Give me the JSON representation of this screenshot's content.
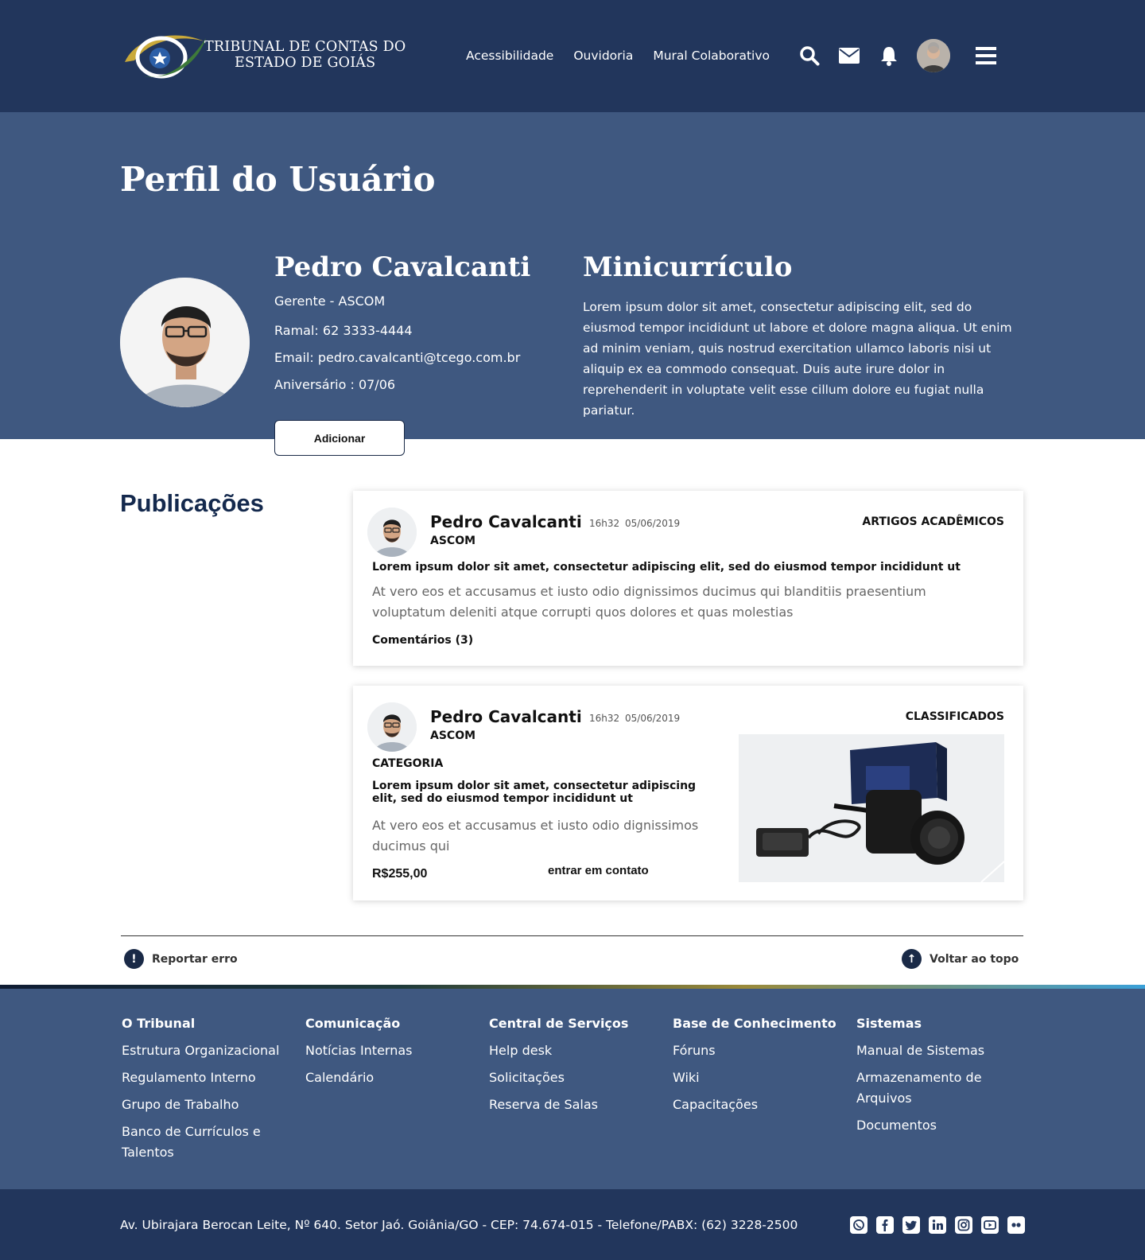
{
  "header": {
    "logo_line1": "TRIBUNAL DE CONTAS DO",
    "logo_line2": "ESTADO DE GOIÁS",
    "nav": [
      "Acessibilidade",
      "Ouvidoria",
      "Mural Colaborativo"
    ],
    "icons": [
      "search-icon",
      "mail-icon",
      "bell-icon",
      "avatar",
      "menu-icon"
    ]
  },
  "profile": {
    "page_title": "Perfil do Usuário",
    "name": "Pedro Cavalcanti",
    "role": "Gerente - ASCOM",
    "extension": "Ramal: 62 3333-4444",
    "email": "Email: pedro.cavalcanti@tcego.com.br",
    "birthday": "Aniversário : 07/06",
    "add_button": "Adicionar",
    "cv_title": "Minicurrículo",
    "cv_text": "Lorem ipsum dolor sit amet, consectetur adipiscing elit, sed do eiusmod tempor incididunt ut labore et dolore magna aliqua. Ut enim ad minim veniam, quis nostrud exercitation ullamco laboris nisi ut aliquip ex ea commodo consequat. Duis aute irure dolor in reprehenderit in voluptate velit esse cillum dolore eu fugiat nulla pariatur."
  },
  "publications": {
    "title": "Publicações",
    "posts": [
      {
        "author": "Pedro Cavalcanti",
        "dept": "ASCOM",
        "time": "16h32",
        "date": "05/06/2019",
        "tag": "ARTIGOS ACADÊMICOS",
        "headline": "Lorem ipsum dolor sit amet, consectetur adipiscing elit, sed do eiusmod tempor incididunt ut",
        "body": "At vero eos et accusamus et iusto odio dignissimos ducimus qui blanditiis praesentium voluptatum deleniti atque corrupti quos dolores et quas molestias",
        "comments": "Comentários (3)"
      },
      {
        "author": "Pedro Cavalcanti",
        "dept": "ASCOM",
        "time": "16h32",
        "date": "05/06/2019",
        "tag": "CLASSIFICADOS",
        "category": "CATEGORIA",
        "headline": "Lorem ipsum dolor sit amet, consectetur adipiscing elit, sed do eiusmod tempor incididunt ut",
        "body": "At vero eos et accusamus et iusto odio dignissimos ducimus qui",
        "price": "R$255,00",
        "contact": "entrar em contato"
      }
    ]
  },
  "actions": {
    "report": "Reportar erro",
    "back_to_top": "Voltar ao topo"
  },
  "footer": {
    "columns": [
      {
        "title": "O Tribunal",
        "links": [
          "Estrutura Organizacional",
          "Regulamento Interno",
          "Grupo de Trabalho",
          "Banco de Currículos e Talentos"
        ]
      },
      {
        "title": "Comunicação",
        "links": [
          "Notícias Internas",
          "Calendário"
        ]
      },
      {
        "title": "Central de Serviços",
        "links": [
          "Help desk",
          "Solicitações",
          "Reserva de Salas"
        ]
      },
      {
        "title": "Base de Conhecimento",
        "links": [
          "Fóruns",
          "Wiki",
          "Capacitações"
        ]
      },
      {
        "title": "Sistemas",
        "links": [
          "Manual de Sistemas",
          "Armazenamento de Arquivos",
          "Documentos"
        ]
      }
    ],
    "address": "Av. Ubirajara Berocan Leite, Nº 640. Setor Jaó. Goiânia/GO - CEP: 74.674-015 - Telefone/PABX: (62) 3228-2500",
    "socials": [
      "whatsapp-icon",
      "facebook-icon",
      "twitter-icon",
      "linkedin-icon",
      "instagram-icon",
      "youtube-icon",
      "flickr-icon"
    ]
  },
  "colors": {
    "header_bg": "#22365c",
    "hero_bg": "#3f5880",
    "title_navy": "#14294d"
  }
}
